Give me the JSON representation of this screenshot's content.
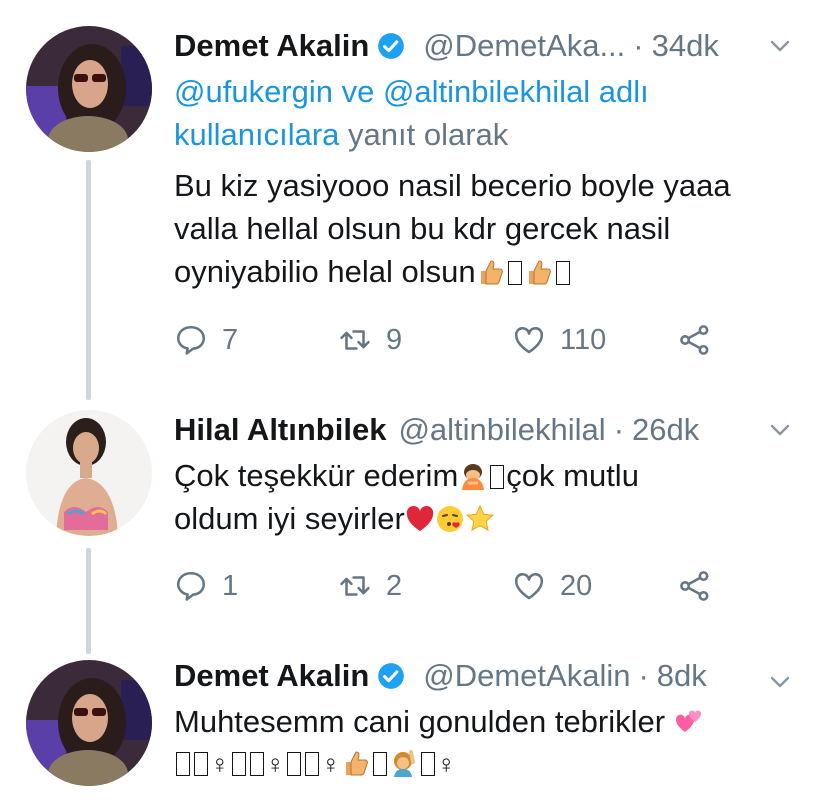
{
  "tweets": [
    {
      "name": "Demet Akalin",
      "handle": "@DemetAka...",
      "time": "34dk",
      "reply_mentions": "@ufukergin ve @altinbilekhilal adlı kullanıcılara",
      "reply_suffix": "yanıt olarak",
      "text_line1": "Bu kiz yasiyooo nasil becerio boyle yaaa",
      "text_line2": "valla hellal olsun bu kdr gercek nasil",
      "text_line3": "oyniyabilio helal olsun",
      "replies": "7",
      "retweets": "9",
      "likes": "110"
    },
    {
      "name": "Hilal Altınbilek",
      "handle": "@altinbilekhilal",
      "time": "26dk",
      "text_line1_a": "Çok teşekkür ederim",
      "text_line1_b": "çok mutlu",
      "text_line2": "oldum iyi seyirler",
      "replies": "1",
      "retweets": "2",
      "likes": "20"
    },
    {
      "name": "Demet Akalin",
      "handle": "@DemetAkalin",
      "time": "8dk",
      "text_line1": "Muhtesemm cani gonulden tebrikler"
    }
  ],
  "icons": {
    "reply": "reply-icon",
    "retweet": "retweet-icon",
    "like": "heart-icon",
    "share": "share-icon",
    "verified": "verified-badge-icon",
    "more": "chevron-down-icon"
  },
  "colors": {
    "link": "#1b95e0",
    "muted": "#657786",
    "verified": "#1da1f2",
    "thread_line": "#ccd6dd"
  }
}
